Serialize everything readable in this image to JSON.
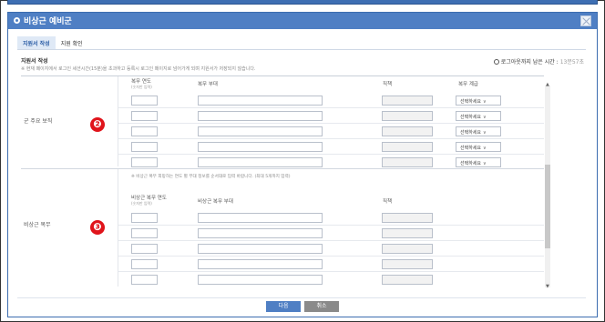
{
  "modal": {
    "title": "비상근 예비군"
  },
  "tabs": [
    {
      "label": "지원서 작성"
    },
    {
      "label": "지원 확인"
    }
  ],
  "form": {
    "section_title": "지원서 작성",
    "notice": "※ 현재 페이지에서 로그인 세션시간(15분)을 초과하고 등록시 로그인 페이지로 넘어가게 되며 지원서가 저장되지 않습니다.",
    "timer_label": "로그아웃까지 남은 시간 :",
    "timer_value": "13분57초"
  },
  "military": {
    "row_label": "군 주요 보직",
    "marker": "❷",
    "columns": {
      "year": "복무 연도",
      "year_sub": "(숫자만 입력)",
      "unit": "복무 부대",
      "position": "직책",
      "rank": "복무 계급"
    },
    "select_placeholder": "선택하세요"
  },
  "reserve": {
    "row_label": "비상근 복무",
    "marker": "❸",
    "guide": "※ 비상근 복무 희망하는 연도 별 부대 정보를 순서대로 입력 바랍니다. (최대 5개까지 입력)",
    "columns": {
      "year": "비상근 복무 연도",
      "year_sub": "(숫자만 입력)",
      "unit": "비상근 복무 부대",
      "position": "직책"
    }
  },
  "buttons": {
    "next": "다음",
    "cancel": "취소"
  },
  "colors": {
    "header": "#4f7fc4",
    "marker": "#e0141b",
    "cancel": "#8a8a8a"
  }
}
